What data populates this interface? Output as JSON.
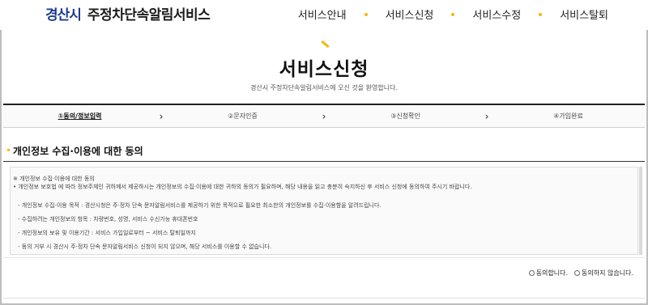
{
  "header": {
    "logo_text": "경산시",
    "service_name": "주정차단속알림서비스",
    "nav": [
      {
        "label": "서비스안내"
      },
      {
        "label": "서비스신청"
      },
      {
        "label": "서비스수정"
      },
      {
        "label": "서비스탈퇴"
      }
    ]
  },
  "main": {
    "title": "서비스신청",
    "subtitle": "경산시 주정차단속알림서비스에 오신 것을 환영합니다."
  },
  "steps": [
    {
      "label": "①동의/정보입력",
      "active": true
    },
    {
      "label": "②문자인증",
      "active": false
    },
    {
      "label": "③신청확인",
      "active": false
    },
    {
      "label": "④가입완료",
      "active": false
    }
  ],
  "section": {
    "heading": "개인정보 수집·이용에 대한 동의"
  },
  "terms": {
    "title": "※ 개인정보 수집·이용에 대한 동의",
    "intro": "• 개인정보 보호법 에 따라 정보주체인 귀하께서 제공하시는 개인정보의 수집·이용에 대한 귀하의 동의가 필요하며, 해당 내용을 읽고 충분히 숙지하신 후 서비스 신청에 동의하여 주시기 바랍니다.",
    "items": [
      "- 개인정보 수집·이용 목적 : 경산시청은 주·정차 단속 문자알림서비스를 제공하기 위한 목적으로 필요한 최소한의 개인정보를 수집·이용함을 알려드립니다.",
      "- 수집하려는 개인정보의 항목 : 차량번호, 성명, 서비스 수신가능 휴대폰번호",
      "- 개인정보의 보유 및 이용기간 : 서비스 가입일로부터 ~ 서비스 탈퇴일까지",
      "- 동의 거부 시 경산시 주·정차 단속 문자알림서비스 신청이 되지 않으며, 해당 서비스를 이용할 수 없습니다."
    ]
  },
  "consent": {
    "agree_label": "동의합니다.",
    "disagree_label": "동의하지 않습니다."
  },
  "colors": {
    "accent": "#f5b800",
    "logo": "#1f3b8f"
  }
}
